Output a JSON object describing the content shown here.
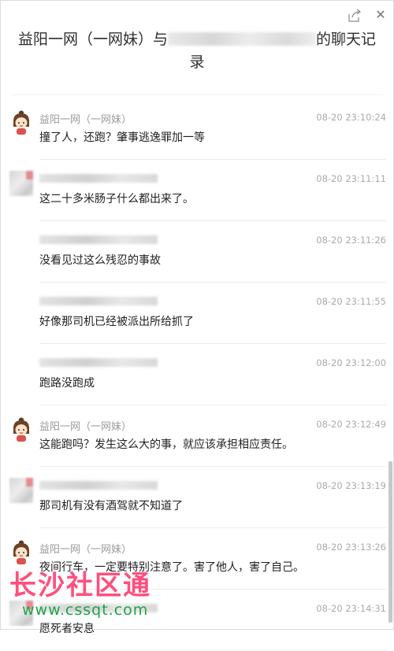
{
  "window": {
    "title_prefix": "益阳一网（一网妹）与",
    "title_suffix": "的聊天记录",
    "share_icon": "share-icon",
    "close_icon": "close-icon"
  },
  "messages": [
    {
      "sender": "益阳一网（一网妹）",
      "sender_visible": true,
      "avatar": "cartoon-avatar",
      "time": "08-20 23:10:24",
      "text": "撞了人，还跑？肇事逃逸罪加一等"
    },
    {
      "sender_visible": false,
      "avatar": "blurred-avatar",
      "time": "08-20 23:11:11",
      "text": "这二十多米肠子什么都出来了。"
    },
    {
      "sender_visible": false,
      "time": "08-20 23:11:26",
      "text": "没看见过这么残忍的事故"
    },
    {
      "sender_visible": false,
      "time": "08-20 23:11:55",
      "text": "好像那司机已经被派出所给抓了"
    },
    {
      "sender_visible": false,
      "time": "08-20 23:12:00",
      "text": "跑路没跑成"
    },
    {
      "sender": "益阳一网（一网妹）",
      "sender_visible": true,
      "avatar": "cartoon-avatar",
      "time": "08-20 23:12:49",
      "text": "这能跑吗？发生这么大的事，就应该承担相应责任。"
    },
    {
      "sender_visible": false,
      "avatar": "blurred-avatar",
      "time": "08-20 23:13:19",
      "text": "那司机有没有酒驾就不知道了"
    },
    {
      "sender": "益阳一网（一网妹）",
      "sender_visible": true,
      "avatar": "cartoon-avatar",
      "time": "08-20 23:13:26",
      "text": "夜间行车，一定要特别注意了。害了他人，害了自己。"
    },
    {
      "sender_visible": false,
      "avatar": "blurred-avatar",
      "time": "08-20 23:14:31",
      "text": "愿死者安息"
    }
  ],
  "watermark": {
    "text": "长沙社区通",
    "url": "www.cssqt.com"
  },
  "colors": {
    "text": "#1f1f1f",
    "meta": "#aaaaaa",
    "watermark_text": "#ff4f7d",
    "watermark_url": "#1fa34a"
  }
}
